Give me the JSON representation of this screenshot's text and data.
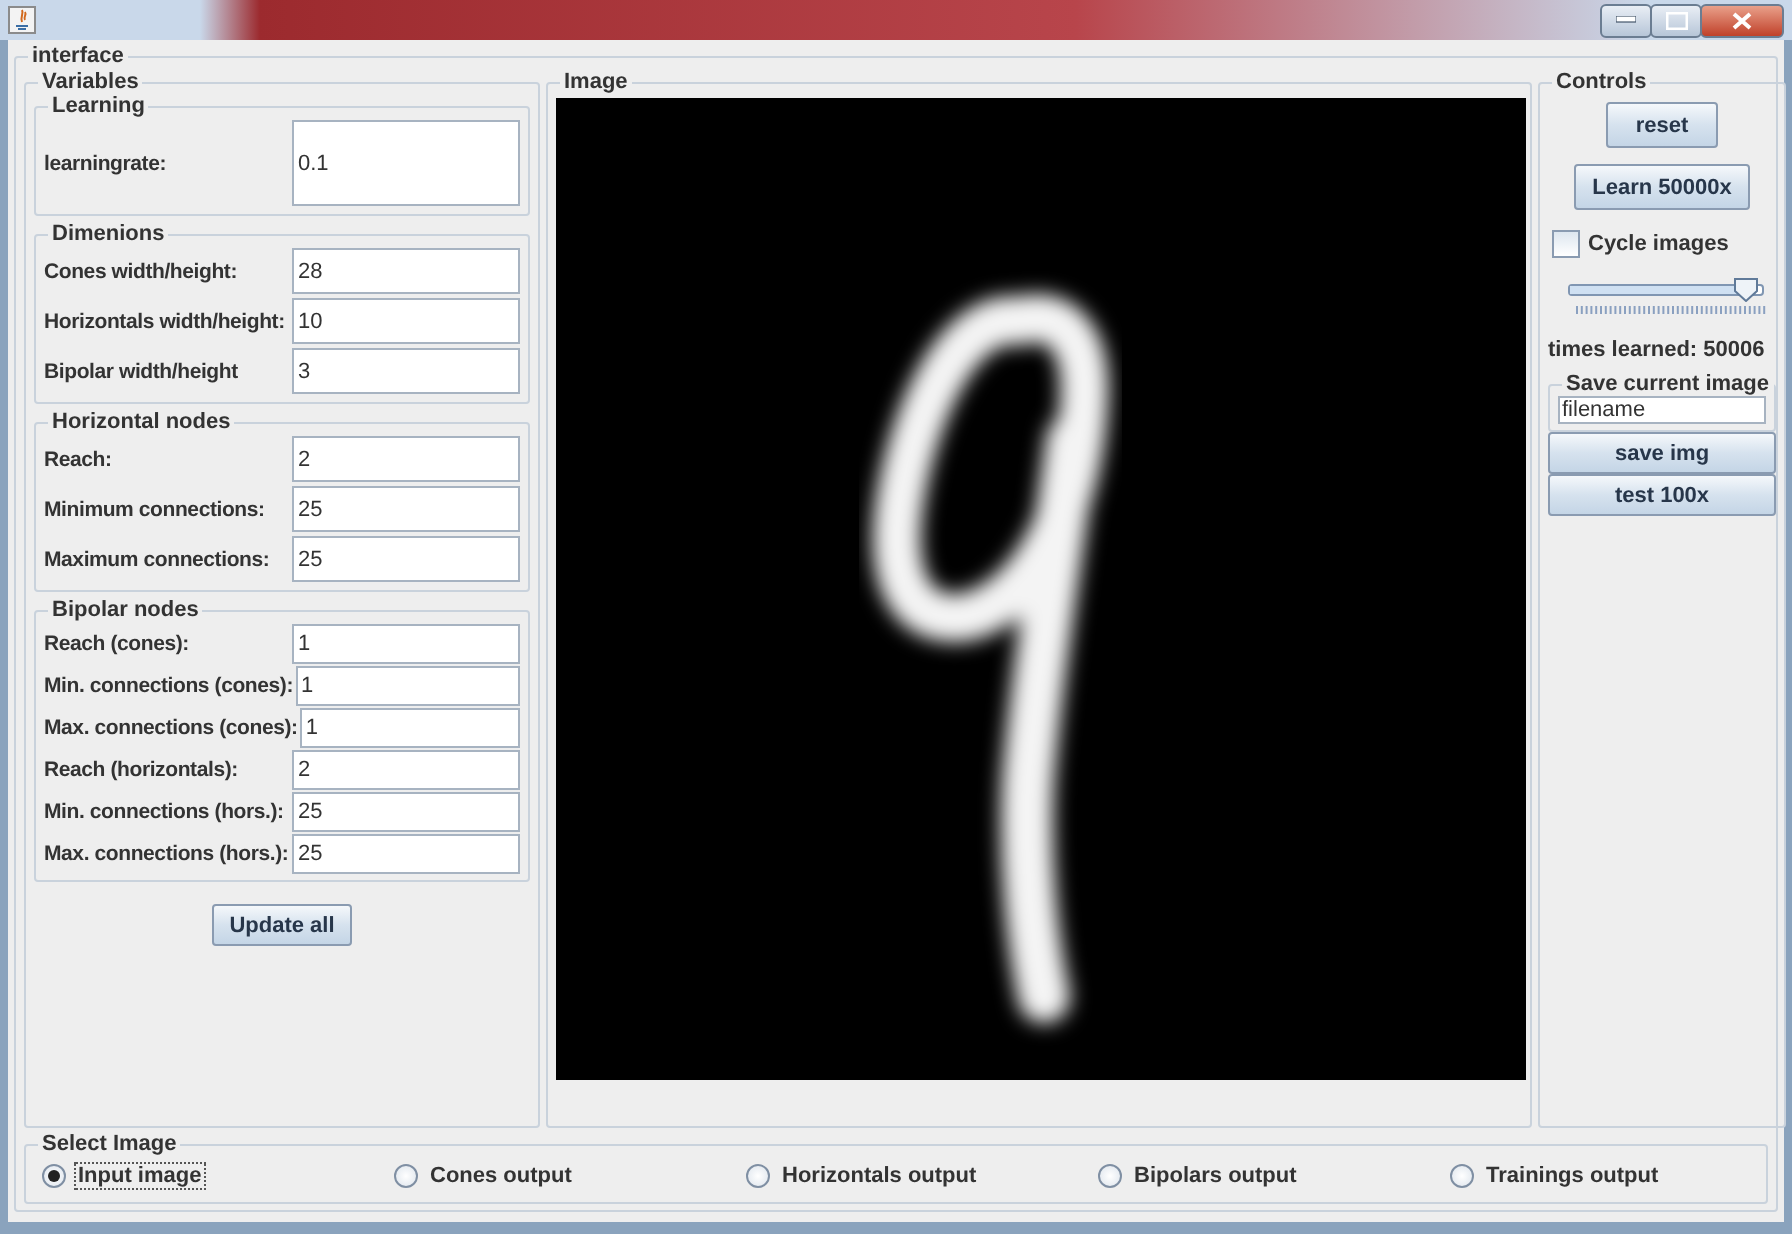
{
  "frame": {
    "title": "interface"
  },
  "variables": {
    "title": "Variables",
    "groups": [
      {
        "title": "Learning",
        "fields": [
          {
            "label": "learningrate:",
            "value": "0.1"
          }
        ]
      },
      {
        "title": "Dimenions",
        "fields": [
          {
            "label": "Cones width/height:",
            "value": "28"
          },
          {
            "label": "Horizontals width/height:",
            "value": "10"
          },
          {
            "label": "Bipolar width/height",
            "value": "3"
          }
        ]
      },
      {
        "title": "Horizontal nodes",
        "fields": [
          {
            "label": "Reach:",
            "value": "2"
          },
          {
            "label": "Minimum connections:",
            "value": "25"
          },
          {
            "label": "Maximum connections:",
            "value": "25"
          }
        ]
      },
      {
        "title": "Bipolar nodes",
        "fields": [
          {
            "label": "Reach (cones):",
            "value": "1"
          },
          {
            "label": "Min. connections (cones):",
            "value": "1"
          },
          {
            "label": "Max. connections (cones):",
            "value": "1"
          },
          {
            "label": "Reach (horizontals):",
            "value": "2"
          },
          {
            "label": "Min. connections (hors.):",
            "value": "25"
          },
          {
            "label": "Max. connections (hors.):",
            "value": "25"
          }
        ]
      }
    ],
    "update_button": "Update all"
  },
  "image_panel": {
    "title": "Image"
  },
  "controls": {
    "title": "Controls",
    "reset_button": "reset",
    "learn_button": "Learn 50000x",
    "cycle_checkbox": {
      "label": "Cycle images",
      "checked": false
    },
    "slider": {
      "level": 0.97
    },
    "times_learned": "times learned: 50006",
    "save_group": {
      "title": "Save current image",
      "filename": "filename"
    },
    "save_button": "save img",
    "test_button": "test 100x"
  },
  "select_image": {
    "title": "Select Image",
    "options": [
      {
        "label": "Input image",
        "selected": true
      },
      {
        "label": "Cones output",
        "selected": false
      },
      {
        "label": "Horizontals output",
        "selected": false
      },
      {
        "label": "Bipolars output",
        "selected": false
      },
      {
        "label": "Trainings output",
        "selected": false
      }
    ]
  }
}
